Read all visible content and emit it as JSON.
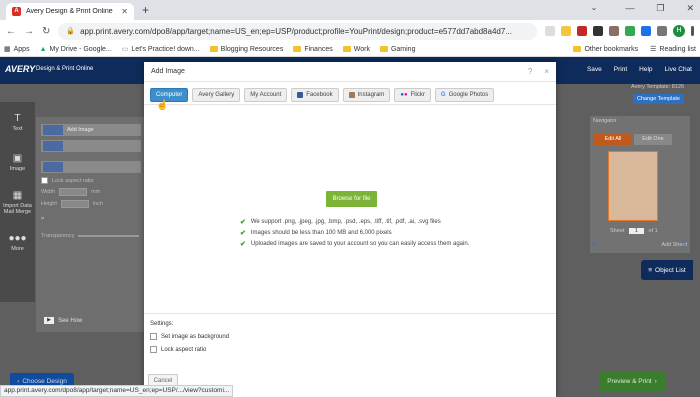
{
  "browser": {
    "tab_title": "Avery Design & Print Online",
    "url": "app.print.avery.com/dpo8/app/target;name=US_en;ep=USP/product;profile=YouPrint/design;product=e577dd7abd8a4d7...",
    "bookmarks": [
      "Apps",
      "My Drive - Google...",
      "Let's Practice! down...",
      "Blogging Resources",
      "Finances",
      "Work",
      "Gaming"
    ],
    "bookmarks_right": [
      "Other bookmarks",
      "Reading list"
    ],
    "avatar_letter": "H",
    "status_url": "app.print.avery.com/dpo8/app/target;name=US_en;ep=USP/.../view?customi..."
  },
  "avery": {
    "logo": "AVERY",
    "logo_sub": "Design & Print Online",
    "header_buttons": [
      "Save",
      "Print",
      "Help",
      "Live Chat"
    ],
    "rail": [
      "Text",
      "Image",
      "Import Data Mail Merge",
      "More"
    ],
    "left_panel": {
      "add_image": "Add Image",
      "lock_aspect": "Lock aspect ratio",
      "width": "Width",
      "height": "Height",
      "unit_mm": "mm",
      "unit_inch": "inch",
      "transparency": "Transparency",
      "see_how": "See How"
    },
    "template_label": "Avery Template: 8126",
    "change_template": "Change Template",
    "navigator": "Navigator",
    "edit_all": "Edit All",
    "edit_one": "Edit One",
    "sheet": "Sheet",
    "sheet_value": "1",
    "sheet_of": "of 1",
    "add_sheet": "Add Sheet",
    "object_list": "Object List",
    "choose_design": "Choose Design",
    "preview_print": "Preview & Print"
  },
  "modal": {
    "title": "Add Image",
    "help": "?",
    "close": "×",
    "tabs": [
      "Computer",
      "Avery Gallery",
      "My Account",
      "Facebook",
      "Instagram",
      "Flickr",
      "Google Photos"
    ],
    "active_tab": "Computer",
    "browse_label": "Browse for file",
    "info": [
      "We support .png, .jpeg, .jpg, .bmp, .psd, .eps, .tiff, .tif, .pdf, .ai, .svg files",
      "Images should be less than 100 MB and 6,000 pixels",
      "Uploaded images are saved to your account so you can easily access them again."
    ],
    "settings_label": "Settings:",
    "options": [
      "Set image as background",
      "Lock aspect ratio"
    ],
    "cancel": "Cancel"
  }
}
